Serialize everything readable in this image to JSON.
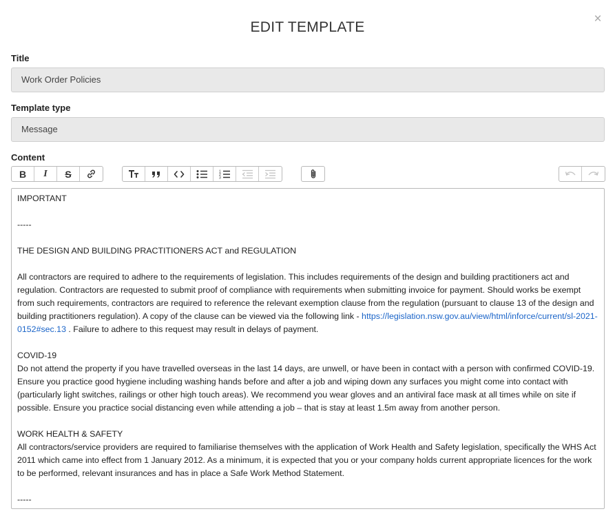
{
  "dialog": {
    "title": "EDIT TEMPLATE",
    "close_glyph": "×"
  },
  "fields": {
    "title_label": "Title",
    "title_value": "Work Order Policies",
    "type_label": "Template type",
    "type_value": "Message",
    "content_label": "Content"
  },
  "toolbar": {
    "bold": "B",
    "italic": "I",
    "strike": "S",
    "icons": [
      "bold-icon",
      "italic-icon",
      "strikethrough-icon",
      "link-icon",
      "heading-icon",
      "quote-icon",
      "code-icon",
      "bullet-list-icon",
      "numbered-list-icon",
      "outdent-icon",
      "indent-icon",
      "attachment-icon",
      "undo-icon",
      "redo-icon"
    ],
    "disabled": [
      "outdent",
      "indent",
      "undo",
      "redo"
    ]
  },
  "content": {
    "important": "IMPORTANT",
    "sep1": "-----",
    "dbp_heading": "THE DESIGN AND BUILDING PRACTITIONERS ACT and REGULATION",
    "dbp_text_before_link": "All contractors are required to adhere to the requirements of legislation. This includes requirements of the design and building practitioners act and regulation. Contractors are requested to submit proof of compliance with requirements when submitting invoice for payment. Should works be exempt from such requirements, contractors are required to reference the relevant exemption clause from the regulation (pursuant to clause 13 of the design and building practitioners regulation). A copy of the clause can be viewed via the following link - ",
    "dbp_link": "https://legislation.nsw.gov.au/view/html/inforce/current/sl-2021-0152#sec.13",
    "dbp_text_after_link": " . Failure to adhere to this request may result in delays of payment.",
    "covid_heading": "COVID-19",
    "covid_text": "Do not attend the property if you have travelled overseas in the last 14 days, are unwell, or have been in contact with a person with confirmed COVID-19. Ensure you practice good hygiene including washing hands before and after a job and wiping down any surfaces you might come into contact with (particularly light switches, railings or other high touch areas). We recommend you wear gloves and an antiviral face mask at all times while on site if possible. Ensure you practice social distancing even while attending a job – that is stay at least 1.5m away from another person.",
    "whs_heading": "WORK HEALTH & SAFETY",
    "whs_text": "All contractors/service providers are required to familiarise themselves with the application of Work Health and Safety legislation, specifically the WHS Act 2011 which came into effect from 1 January 2012. As a minimum, it is expected that you or your company holds current appropriate licences for the work to be performed, relevant insurances and has in place a Safe Work Method Statement.",
    "sep2": "-----"
  }
}
